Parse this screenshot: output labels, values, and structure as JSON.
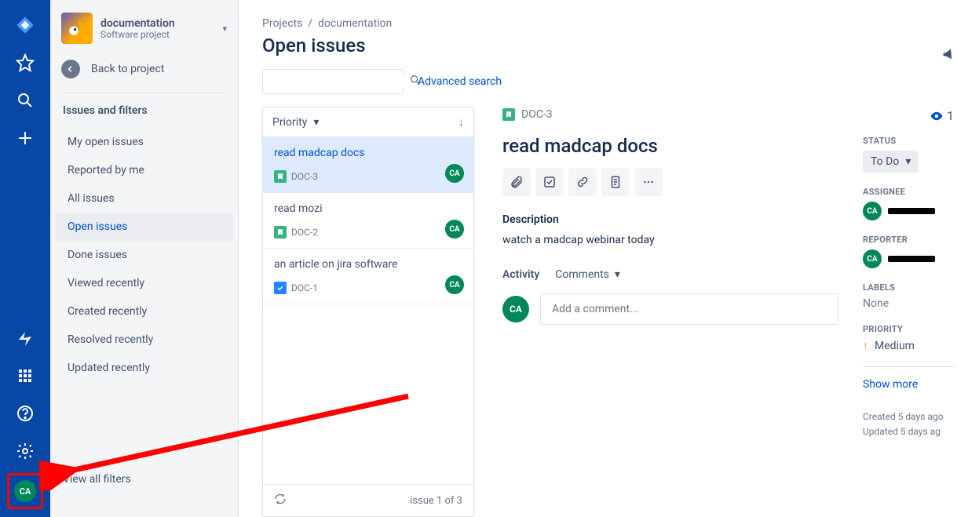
{
  "iconbar": {
    "avatar_initials": "CA"
  },
  "sidebar": {
    "project_name": "documentation",
    "project_type": "Software project",
    "back_label": "Back to project",
    "section_title": "Issues and filters",
    "filters": [
      {
        "label": "My open issues"
      },
      {
        "label": "Reported by me"
      },
      {
        "label": "All issues"
      },
      {
        "label": "Open issues",
        "active": true
      },
      {
        "label": "Done issues"
      },
      {
        "label": "Viewed recently"
      },
      {
        "label": "Created recently"
      },
      {
        "label": "Resolved recently"
      },
      {
        "label": "Updated recently"
      }
    ],
    "view_all": "View all filters"
  },
  "breadcrumb": {
    "root": "Projects",
    "sep": "/",
    "project": "documentation"
  },
  "page_title": "Open issues",
  "search": {
    "placeholder": "",
    "advanced": "Advanced search"
  },
  "issue_list": {
    "sort_label": "Priority",
    "items": [
      {
        "title": "read madcap docs",
        "key": "DOC-3",
        "type": "story",
        "assignee": "CA",
        "selected": true
      },
      {
        "title": "read mozi",
        "key": "DOC-2",
        "type": "story",
        "assignee": "CA"
      },
      {
        "title": "an article on jira software",
        "key": "DOC-1",
        "type": "task",
        "assignee": "CA"
      }
    ],
    "footer_count": "issue 1 of 3"
  },
  "detail": {
    "key": "DOC-3",
    "title": "read madcap docs",
    "watchers": "1",
    "description_label": "Description",
    "description_text": "watch a madcap webinar today",
    "activity_label": "Activity",
    "comments_label": "Comments",
    "comment_placeholder": "Add a comment...",
    "status_label": "STATUS",
    "status_value": "To Do",
    "assignee_label": "ASSIGNEE",
    "reporter_label": "REPORTER",
    "labels_label": "LABELS",
    "labels_value": "None",
    "priority_label": "PRIORITY",
    "priority_value": "Medium",
    "show_more": "Show more",
    "created": "Created 5 days ago",
    "updated": "Updated 5 days ag",
    "avatar_initials": "CA"
  }
}
